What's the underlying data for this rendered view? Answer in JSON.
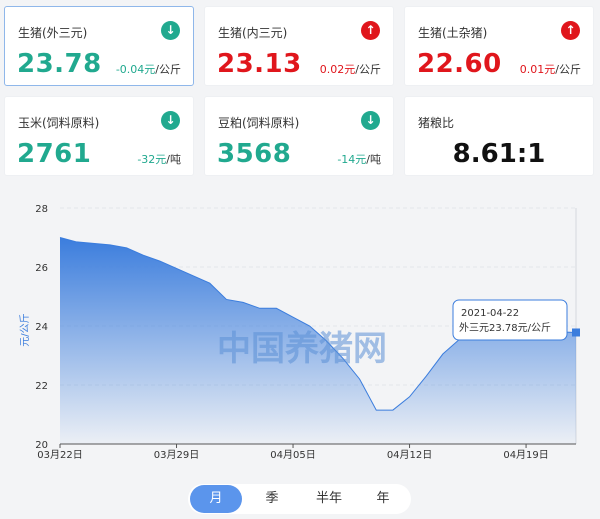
{
  "colors": {
    "down": "#21a98f",
    "up": "#e0161c",
    "accent": "#3b7ddd"
  },
  "cards": [
    {
      "name": "生猪(外三元)",
      "price": "23.78",
      "change": "-0.04元",
      "unit": "/公斤",
      "trend": "down",
      "icon": "arrow-down-circle-icon",
      "selected": true
    },
    {
      "name": "生猪(内三元)",
      "price": "23.13",
      "change": "0.02元",
      "unit": "/公斤",
      "trend": "up",
      "icon": "arrow-up-circle-icon"
    },
    {
      "name": "生猪(土杂猪)",
      "price": "22.60",
      "change": "0.01元",
      "unit": "/公斤",
      "trend": "up",
      "icon": "arrow-up-circle-icon"
    },
    {
      "name": "玉米(饲料原料)",
      "price": "2761",
      "change": "-32元",
      "unit": "/吨",
      "trend": "down",
      "icon": "arrow-down-circle-icon"
    },
    {
      "name": "豆粕(饲料原料)",
      "price": "3568",
      "change": "-14元",
      "unit": "/吨",
      "trend": "down",
      "icon": "arrow-down-circle-icon"
    },
    {
      "name": "猪粮比",
      "value": "8.61:1"
    }
  ],
  "chart_data": {
    "type": "area",
    "ylabel": "元/公斤",
    "ylim": [
      20,
      28
    ],
    "yticks": [
      "20",
      "22",
      "24",
      "26",
      "28"
    ],
    "xticks": [
      "03月22日",
      "03月29日",
      "04月05日",
      "04月12日",
      "04月19日"
    ],
    "x": [
      "03-22",
      "03-23",
      "03-24",
      "03-25",
      "03-26",
      "03-27",
      "03-28",
      "03-29",
      "03-30",
      "03-31",
      "04-01",
      "04-02",
      "04-03",
      "04-04",
      "04-05",
      "04-06",
      "04-07",
      "04-08",
      "04-09",
      "04-10",
      "04-11",
      "04-12",
      "04-13",
      "04-14",
      "04-15",
      "04-16",
      "04-17",
      "04-18",
      "04-19",
      "04-20",
      "04-21",
      "04-22"
    ],
    "series": [
      {
        "values": [
          27.0,
          26.85,
          26.8,
          26.75,
          26.65,
          26.4,
          26.2,
          25.95,
          25.7,
          25.45,
          24.9,
          24.8,
          24.6,
          24.6,
          24.3,
          24.0,
          23.5,
          22.9,
          22.2,
          21.15,
          21.15,
          21.6,
          22.3,
          23.05,
          23.55,
          23.8,
          23.85,
          23.8,
          23.85,
          23.8,
          23.8,
          23.78
        ]
      }
    ],
    "grid": true,
    "watermark": "中国养猪网",
    "tooltip": {
      "date": "2021-04-22",
      "label": "外三元23.78元/公斤"
    }
  },
  "period_tabs": [
    "月",
    "季",
    "半年",
    "年"
  ],
  "active_tab": 0
}
